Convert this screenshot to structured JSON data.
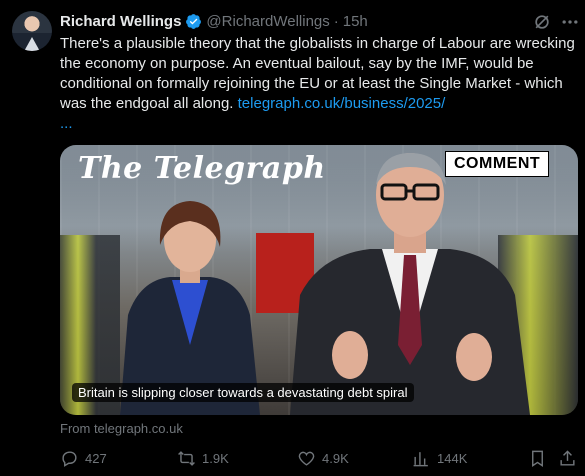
{
  "author": {
    "name": "Richard Wellings",
    "handle": "@RichardWellings",
    "separator": "·",
    "time": "15h"
  },
  "tweet": {
    "text": "There's a plausible theory that the globalists in charge of Labour are wrecking the economy on purpose. An eventual bailout, say by the IMF, would be conditional on formally rejoining the EU or at least the Single Market - which was the endgoal all along. ",
    "link": "telegraph.co.uk/business/2025/",
    "link_ellipsis": "..."
  },
  "card": {
    "logo": "The Telegraph",
    "badge": "COMMENT",
    "caption": "Britain is slipping closer towards a devastating debt spiral"
  },
  "source": "From telegraph.co.uk",
  "actions": {
    "replies": "427",
    "reposts": "1.9K",
    "likes": "4.9K",
    "views": "144K"
  },
  "icons": {
    "verified": "verified-badge-icon",
    "grok": "grok-icon",
    "more": "more-options-icon",
    "reply": "reply-icon",
    "repost": "repost-icon",
    "like": "like-icon",
    "views": "views-icon",
    "bookmark": "bookmark-icon",
    "share": "share-icon"
  },
  "colors": {
    "background": "#000000",
    "text": "#e7e9ea",
    "muted": "#71767b",
    "link": "#1d9bf0"
  }
}
